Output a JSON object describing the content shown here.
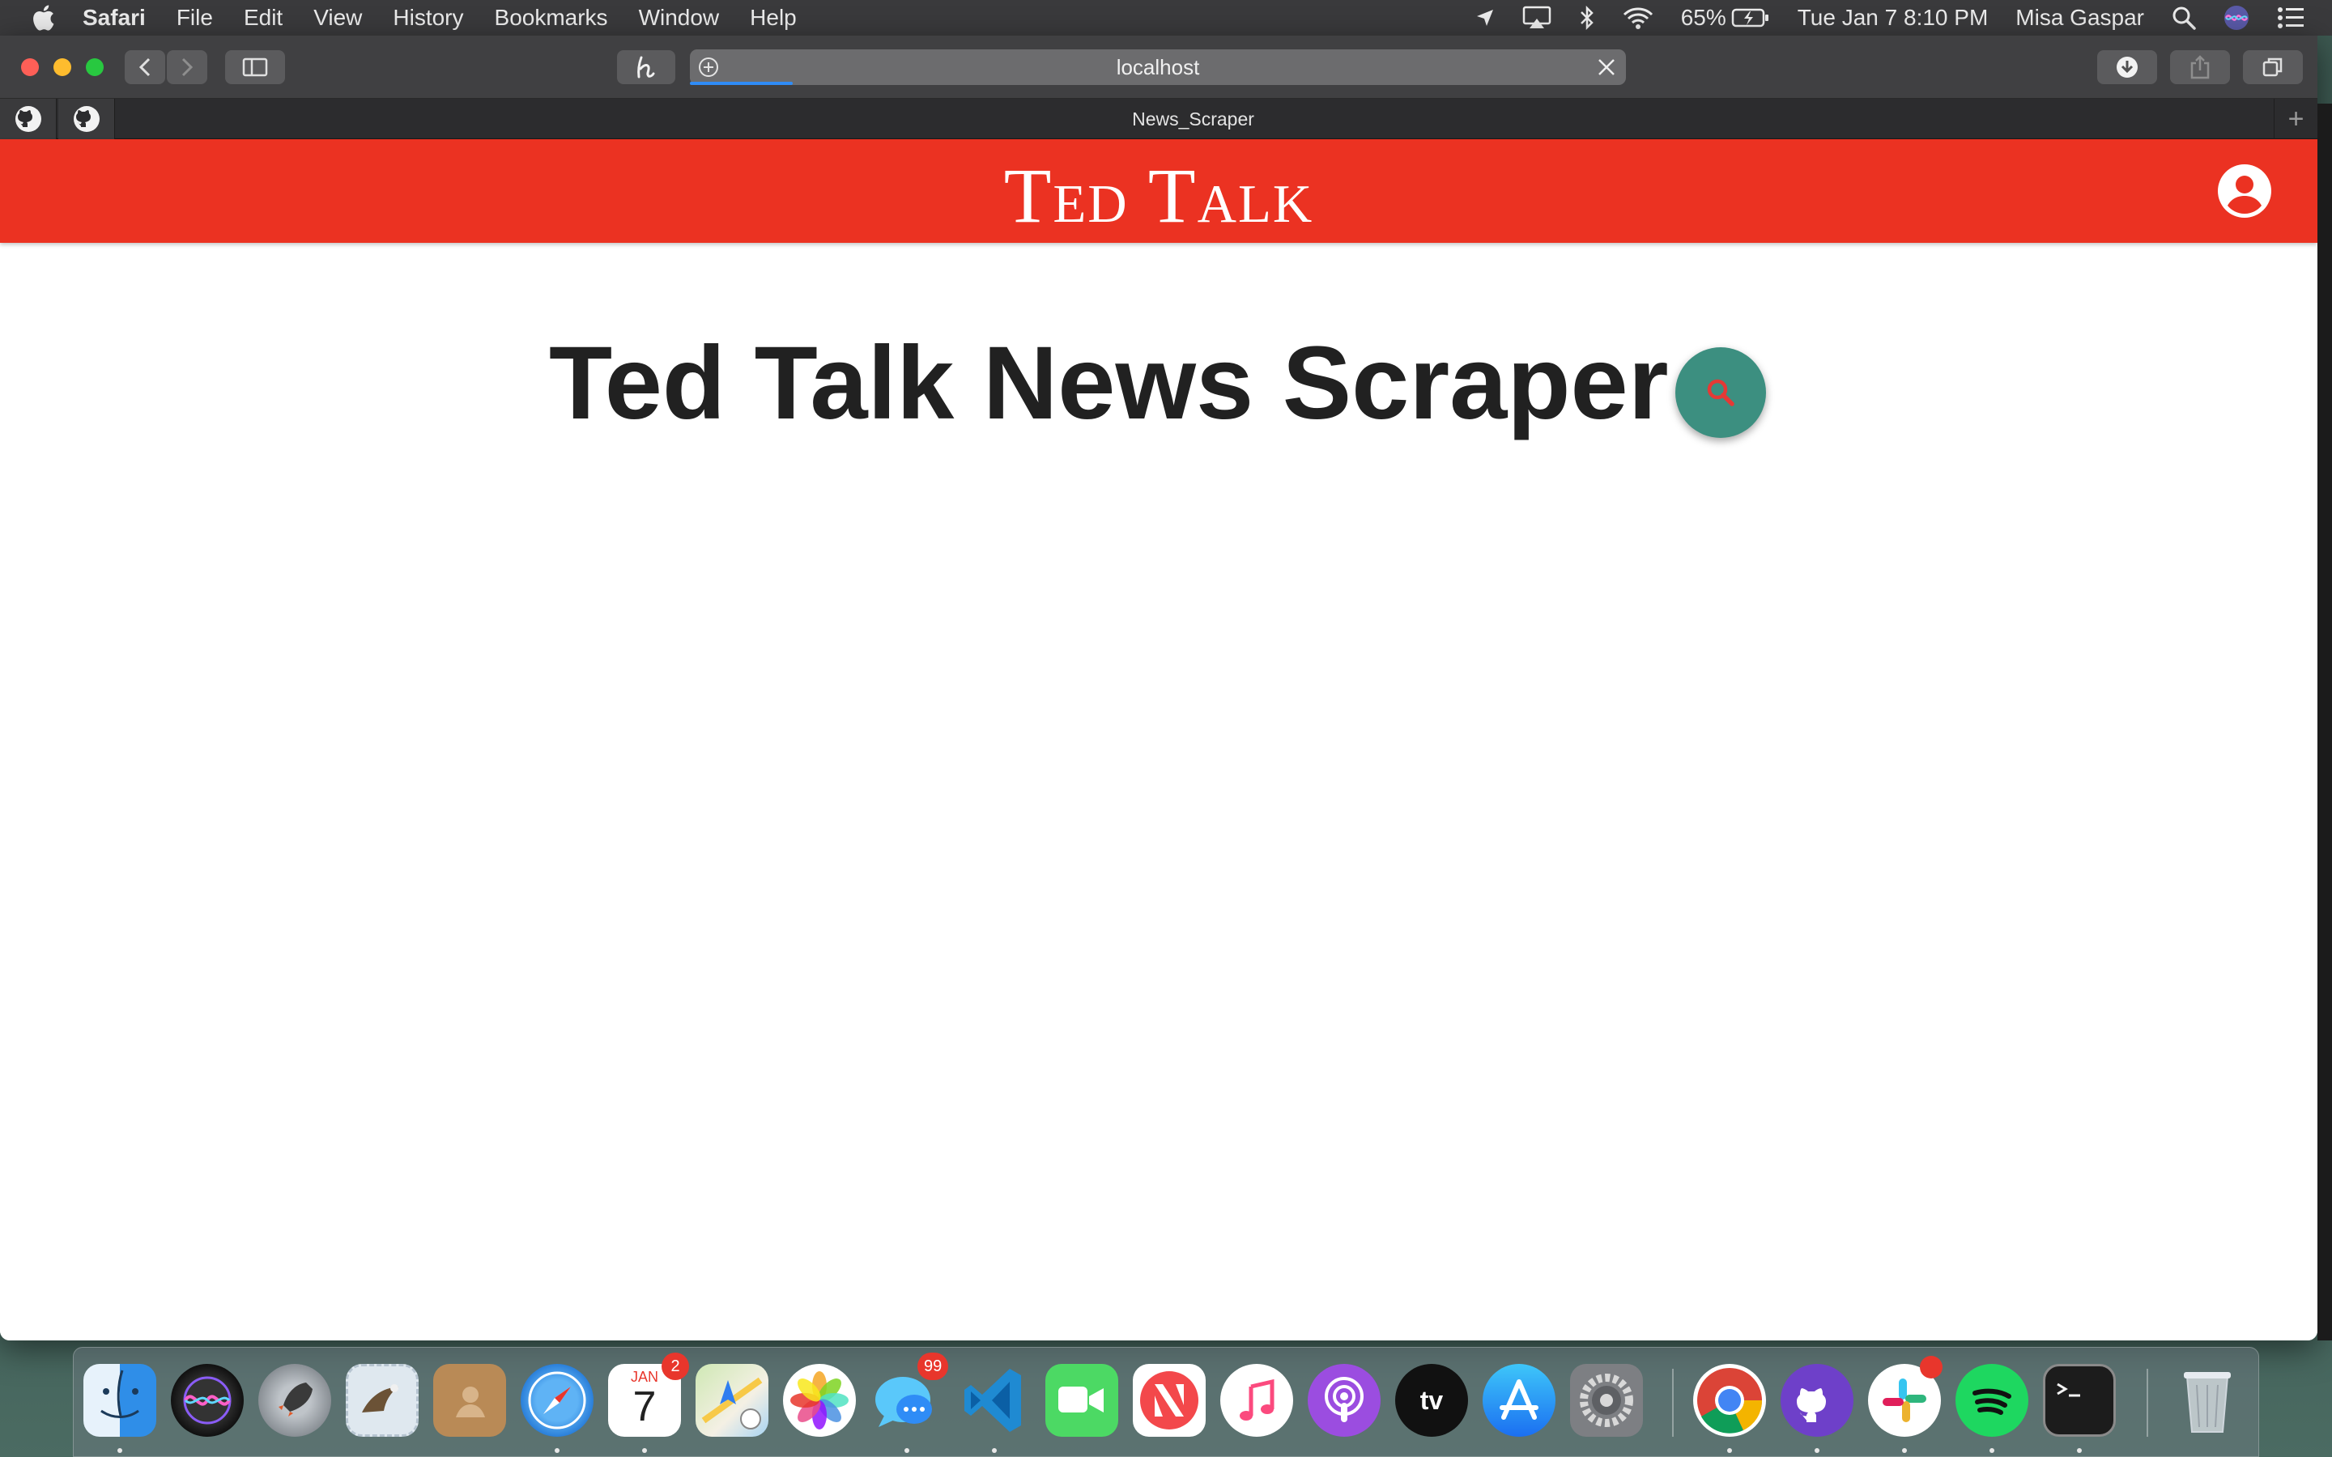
{
  "menubar": {
    "app_name": "Safari",
    "menus": [
      "File",
      "Edit",
      "View",
      "History",
      "Bookmarks",
      "Window",
      "Help"
    ],
    "battery": "65%",
    "datetime": "Tue Jan 7  8:10 PM",
    "user": "Misa Gaspar"
  },
  "browser": {
    "url": "localhost",
    "tab_title": "News_Scraper",
    "page_load_progress": 0.11,
    "new_tab_symbol": "+"
  },
  "site": {
    "brand": "Ted Talk",
    "page_title": "Ted Talk News Scraper",
    "colors": {
      "header_bg": "#eb3222",
      "fab_bg": "#3c8f80",
      "fab_icon": "#e53935"
    }
  },
  "dock": {
    "apps": [
      "finder-icon",
      "siri-icon",
      "launchpad-icon",
      "mail-icon",
      "contacts-icon",
      "safari-icon",
      "calendar-icon",
      "maps-icon",
      "photos-icon",
      "messages-icon",
      "vscode-icon",
      "facetime-icon",
      "news-icon",
      "music-icon",
      "podcasts-icon",
      "apple-tv-icon",
      "app-store-icon",
      "system-preferences-icon",
      "chrome-icon",
      "github-desktop-icon",
      "slack-icon",
      "spotify-icon",
      "terminal-icon",
      "trash-icon"
    ],
    "calendar_month": "JAN",
    "calendar_day": "7",
    "calendar_badge": "2",
    "messages_badge": "99",
    "tv_label": "tv"
  }
}
